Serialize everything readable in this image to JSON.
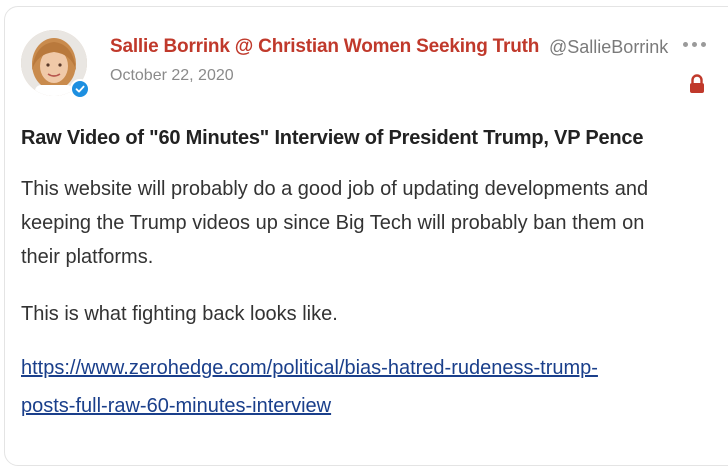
{
  "post": {
    "author_name": "Sallie Borrink @ Christian Women Seeking Truth",
    "author_handle": "@SallieBorrink",
    "date": "October 22, 2020",
    "title": "Raw Video of \"60 Minutes\" Interview of President Trump, VP Pence",
    "paragraph_1_line_1": "This website will probably do a good job of updating developments and",
    "paragraph_1_line_2": "keeping the Trump videos up since Big Tech will probably ban them on",
    "paragraph_1_line_3": "their platforms.",
    "paragraph_2": "This is what fighting back looks like.",
    "link_line_1": "https://www.zerohedge.com/political/bias-hatred-rudeness-trump-",
    "link_line_2": "posts-full-raw-60-minutes-interview"
  },
  "icons": {
    "avatar": "avatar-photo",
    "verified": "verified-check-icon",
    "more": "more-options-icon",
    "lock": "lock-icon"
  },
  "colors": {
    "author_name": "#c0392b",
    "handle": "#7a7a7a",
    "link": "#1a3f8b",
    "verified": "#1d8fe0",
    "lock": "#c0392b"
  }
}
